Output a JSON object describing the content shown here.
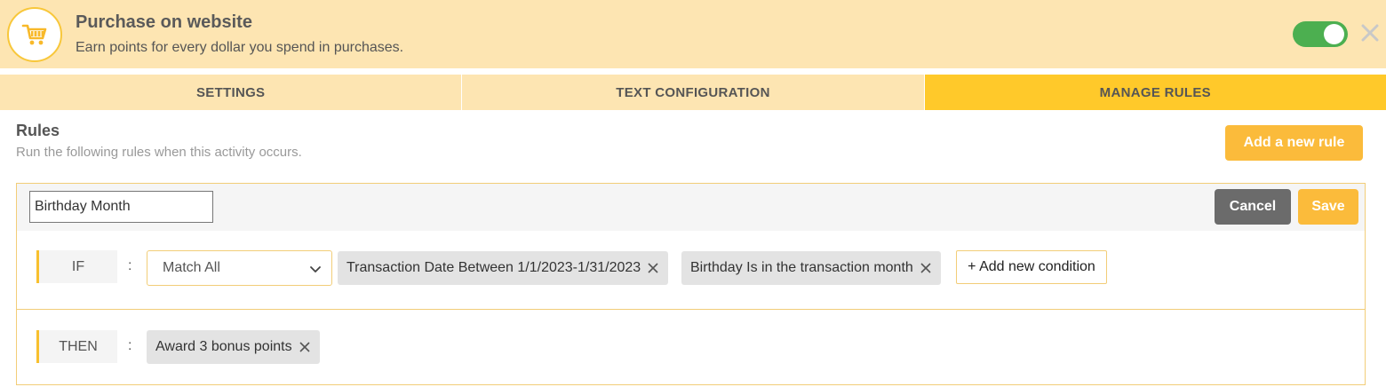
{
  "header": {
    "title": "Purchase on website",
    "subtitle": "Earn points for every dollar you spend in purchases.",
    "icon": "shopping-cart-icon",
    "toggle_on": true,
    "accent_color": "#ffc92a",
    "toggle_color": "#4caf50"
  },
  "tabs": [
    {
      "label": "SETTINGS",
      "active": false
    },
    {
      "label": "TEXT CONFIGURATION",
      "active": false
    },
    {
      "label": "MANAGE RULES",
      "active": true
    }
  ],
  "rules": {
    "title": "Rules",
    "description": "Run the following rules when this activity occurs.",
    "add_button": "Add a new rule"
  },
  "rule": {
    "name_value": "Birthday Month",
    "cancel_label": "Cancel",
    "save_label": "Save",
    "if_label": "IF",
    "then_label": "THEN",
    "colon": ":",
    "match_selected": "Match All",
    "conditions": [
      "Transaction Date Between 1/1/2023-1/31/2023",
      "Birthday Is in the transaction month"
    ],
    "add_condition_label": "+ Add new condition",
    "actions": [
      "Award 3 bonus points"
    ]
  }
}
